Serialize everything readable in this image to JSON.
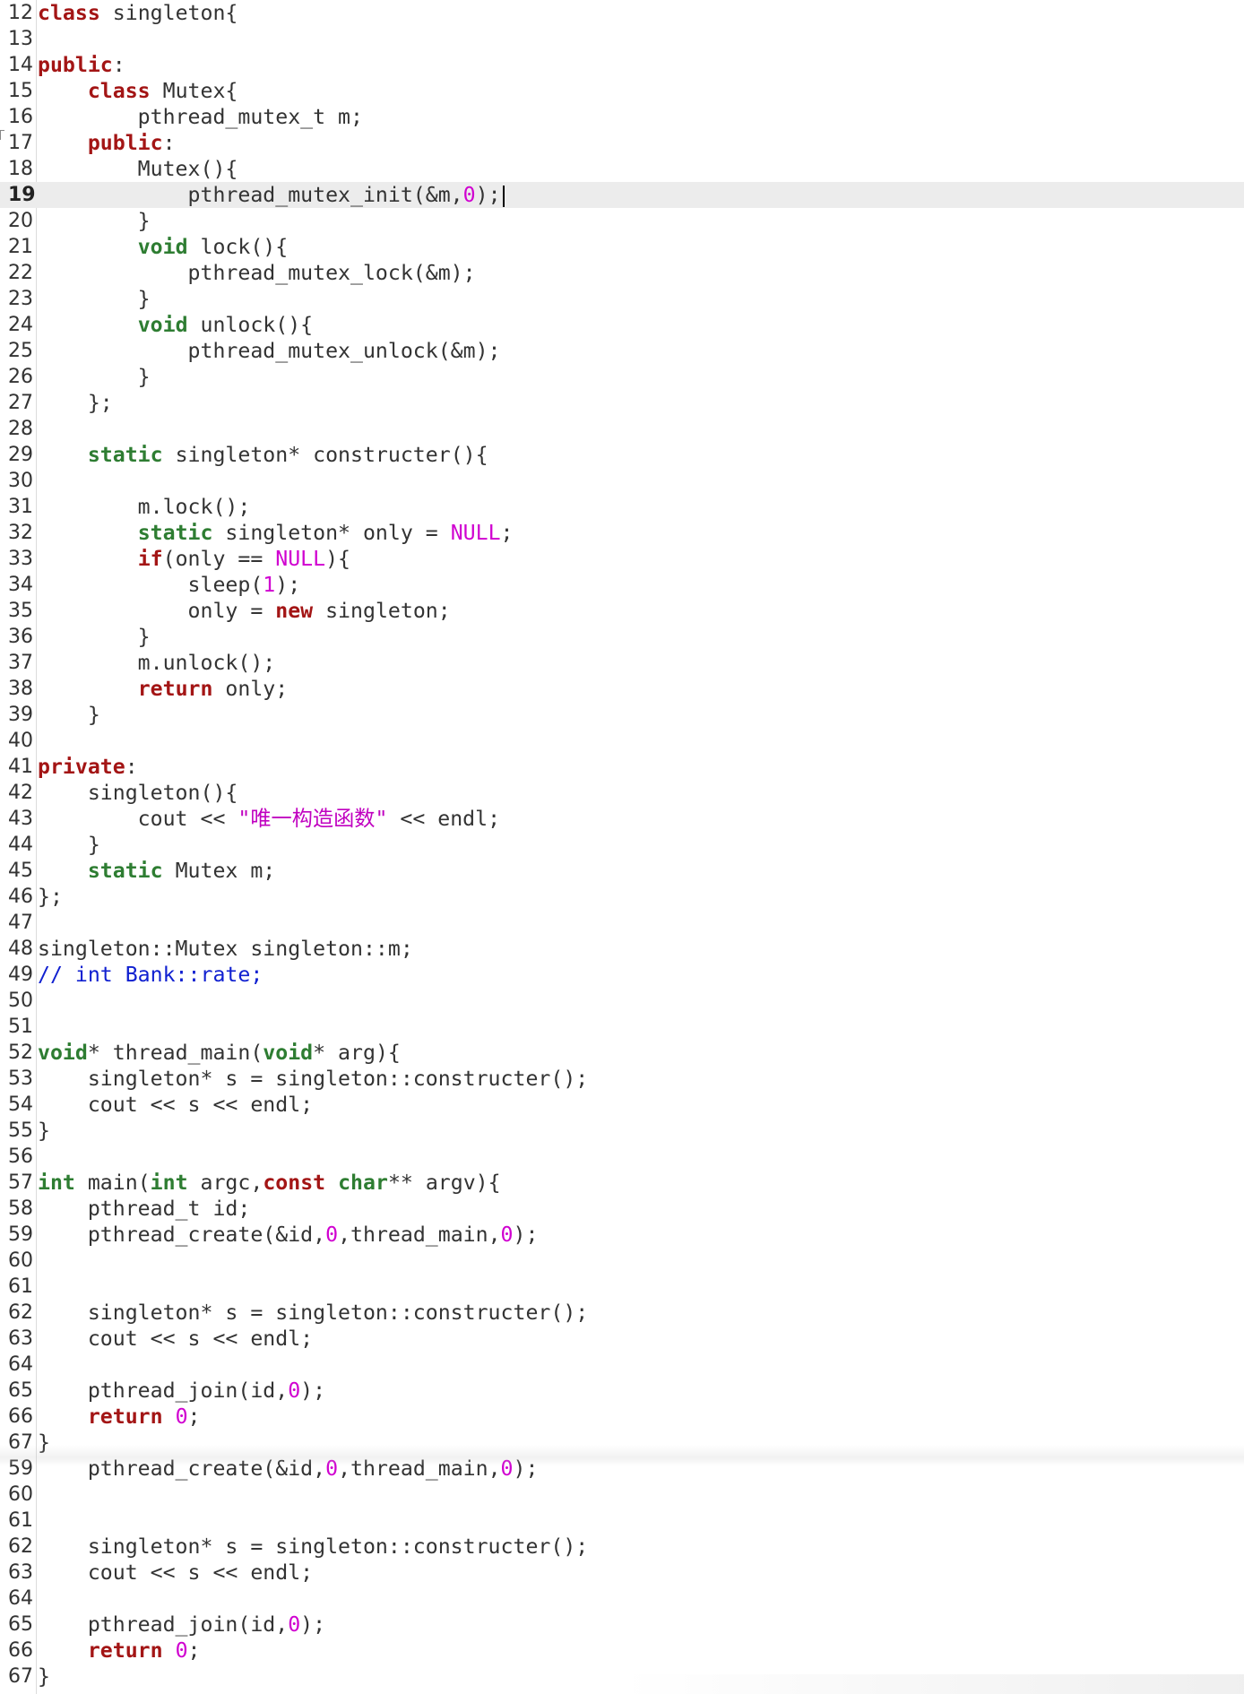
{
  "editor": {
    "language": "cpp",
    "current_line": "19",
    "colors": {
      "keyword": "#a31515",
      "type": "#2e7d32",
      "number": "#d000d0",
      "string": "#c000c0",
      "comment": "#1020d0",
      "text": "#333333",
      "current_line_bg": "#ececec"
    },
    "lines": [
      {
        "n": "12",
        "t": "class singleton{"
      },
      {
        "n": "13",
        "t": ""
      },
      {
        "n": "14",
        "t": "public:"
      },
      {
        "n": "15",
        "t": "    class Mutex{"
      },
      {
        "n": "16",
        "t": "        pthread_mutex_t m;"
      },
      {
        "n": "17",
        "t": "    public:"
      },
      {
        "n": "18",
        "t": "        Mutex(){"
      },
      {
        "n": "19",
        "t": "            pthread_mutex_init(&m,0);"
      },
      {
        "n": "20",
        "t": "        }"
      },
      {
        "n": "21",
        "t": "        void lock(){"
      },
      {
        "n": "22",
        "t": "            pthread_mutex_lock(&m);"
      },
      {
        "n": "23",
        "t": "        }"
      },
      {
        "n": "24",
        "t": "        void unlock(){"
      },
      {
        "n": "25",
        "t": "            pthread_mutex_unlock(&m);"
      },
      {
        "n": "26",
        "t": "        }"
      },
      {
        "n": "27",
        "t": "    };"
      },
      {
        "n": "28",
        "t": ""
      },
      {
        "n": "29",
        "t": "    static singleton* constructer(){"
      },
      {
        "n": "30",
        "t": ""
      },
      {
        "n": "31",
        "t": "        m.lock();"
      },
      {
        "n": "32",
        "t": "        static singleton* only = NULL;"
      },
      {
        "n": "33",
        "t": "        if(only == NULL){"
      },
      {
        "n": "34",
        "t": "            sleep(1);"
      },
      {
        "n": "35",
        "t": "            only = new singleton;"
      },
      {
        "n": "36",
        "t": "        }"
      },
      {
        "n": "37",
        "t": "        m.unlock();"
      },
      {
        "n": "38",
        "t": "        return only;"
      },
      {
        "n": "39",
        "t": "    }"
      },
      {
        "n": "40",
        "t": ""
      },
      {
        "n": "41",
        "t": "private:"
      },
      {
        "n": "42",
        "t": "    singleton(){"
      },
      {
        "n": "43",
        "t": "        cout << \"唯一构造函数\" << endl;"
      },
      {
        "n": "44",
        "t": "    }"
      },
      {
        "n": "45",
        "t": "    static Mutex m;"
      },
      {
        "n": "46",
        "t": "};"
      },
      {
        "n": "47",
        "t": ""
      },
      {
        "n": "48",
        "t": "singleton::Mutex singleton::m;"
      },
      {
        "n": "49",
        "t": "// int Bank::rate;"
      },
      {
        "n": "50",
        "t": ""
      },
      {
        "n": "51",
        "t": ""
      },
      {
        "n": "52",
        "t": "void* thread_main(void* arg){"
      },
      {
        "n": "53",
        "t": "    singleton* s = singleton::constructer();"
      },
      {
        "n": "54",
        "t": "    cout << s << endl;"
      },
      {
        "n": "55",
        "t": "}"
      },
      {
        "n": "56",
        "t": ""
      },
      {
        "n": "57",
        "t": "int main(int argc,const char** argv){"
      },
      {
        "n": "58",
        "t": "    pthread_t id;"
      },
      {
        "n": "59",
        "t": "    pthread_create(&id,0,thread_main,0);"
      },
      {
        "n": "60",
        "t": ""
      },
      {
        "n": "61",
        "t": ""
      },
      {
        "n": "62",
        "t": "    singleton* s = singleton::constructer();"
      },
      {
        "n": "63",
        "t": "    cout << s << endl;"
      },
      {
        "n": "64",
        "t": ""
      },
      {
        "n": "65",
        "t": "    pthread_join(id,0);"
      },
      {
        "n": "66",
        "t": "    return 0;"
      },
      {
        "n": "67",
        "t": "}"
      },
      {
        "n": "59",
        "t": "    pthread_create(&id,0,thread_main,0);"
      },
      {
        "n": "60",
        "t": ""
      },
      {
        "n": "61",
        "t": ""
      },
      {
        "n": "62",
        "t": "    singleton* s = singleton::constructer();"
      },
      {
        "n": "63",
        "t": "    cout << s << endl;"
      },
      {
        "n": "64",
        "t": ""
      },
      {
        "n": "65",
        "t": "    pthread_join(id,0);"
      },
      {
        "n": "66",
        "t": "    return 0;"
      },
      {
        "n": "67",
        "t": "}"
      }
    ]
  }
}
